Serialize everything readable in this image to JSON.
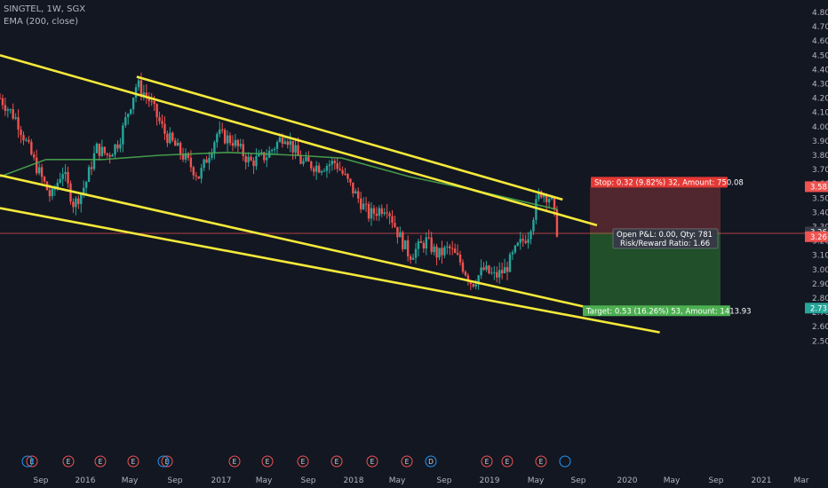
{
  "header": {
    "symbol_line": "SINGTEL, 1W, SGX",
    "indicator_line": "EMA (200, close)"
  },
  "colors": {
    "background": "#131722",
    "up": "#26a69a",
    "down": "#ef5350",
    "ema": "#4caf50",
    "channel": "#f5e93a",
    "stop_zone": "#ef5350",
    "target_zone": "#2e7d32",
    "axis_text": "#b2b5be"
  },
  "chart_data": {
    "type": "candlestick",
    "symbol": "SINGTEL",
    "interval": "1W",
    "exchange": "SGX",
    "y_ticks": [
      "4.80",
      "4.70",
      "4.60",
      "4.50",
      "4.40",
      "4.30",
      "4.20",
      "4.10",
      "4.00",
      "3.90",
      "3.80",
      "3.70",
      "3.60",
      "3.50",
      "3.40",
      "3.30",
      "3.20",
      "3.10",
      "3.00",
      "2.90",
      "2.80",
      "2.70",
      "2.60",
      "2.50"
    ],
    "x_ticks": [
      "Sep",
      "2016",
      "May",
      "Sep",
      "2017",
      "May",
      "Sep",
      "2018",
      "May",
      "Sep",
      "2019",
      "May",
      "Sep",
      "2020",
      "May",
      "Sep",
      "2021",
      "Mar"
    ],
    "ylim": [
      2.45,
      4.85
    ],
    "price_path": [
      [
        "2015-07-01",
        4.2
      ],
      [
        "2015-08-15",
        4.05
      ],
      [
        "2015-10-01",
        3.75
      ],
      [
        "2015-11-15",
        3.5
      ],
      [
        "2015-12-15",
        3.7
      ],
      [
        "2016-01-15",
        3.45
      ],
      [
        "2016-02-15",
        3.6
      ],
      [
        "2016-03-15",
        3.85
      ],
      [
        "2016-04-15",
        3.8
      ],
      [
        "2016-05-15",
        3.9
      ],
      [
        "2016-07-01",
        4.3
      ],
      [
        "2016-08-01",
        4.2
      ],
      [
        "2016-09-15",
        3.95
      ],
      [
        "2016-11-01",
        3.8
      ],
      [
        "2016-12-15",
        3.65
      ],
      [
        "2017-02-01",
        3.95
      ],
      [
        "2017-03-15",
        3.9
      ],
      [
        "2017-05-01",
        3.75
      ],
      [
        "2017-06-15",
        3.8
      ],
      [
        "2017-08-01",
        3.95
      ],
      [
        "2017-09-15",
        3.75
      ],
      [
        "2017-11-01",
        3.72
      ],
      [
        "2017-12-15",
        3.75
      ],
      [
        "2018-02-01",
        3.55
      ],
      [
        "2018-03-15",
        3.38
      ],
      [
        "2018-05-01",
        3.45
      ],
      [
        "2018-06-01",
        3.25
      ],
      [
        "2018-07-01",
        3.1
      ],
      [
        "2018-08-15",
        3.2
      ],
      [
        "2018-09-15",
        3.1
      ],
      [
        "2018-10-15",
        3.15
      ],
      [
        "2018-11-15",
        3.05
      ],
      [
        "2018-12-15",
        2.9
      ],
      [
        "2019-01-15",
        3.0
      ],
      [
        "2019-02-15",
        2.95
      ],
      [
        "2019-03-15",
        3.0
      ],
      [
        "2019-04-15",
        3.15
      ],
      [
        "2019-05-15",
        3.25
      ],
      [
        "2019-06-15",
        3.55
      ],
      [
        "2019-07-15",
        3.5
      ],
      [
        "2019-08-01",
        3.26
      ]
    ],
    "ema_200": [
      [
        "2015-07-01",
        3.65
      ],
      [
        "2015-11-01",
        3.77
      ],
      [
        "2016-04-01",
        3.77
      ],
      [
        "2016-09-01",
        3.8
      ],
      [
        "2017-03-01",
        3.82
      ],
      [
        "2017-09-01",
        3.8
      ],
      [
        "2018-01-01",
        3.78
      ],
      [
        "2018-07-01",
        3.65
      ],
      [
        "2019-01-01",
        3.55
      ],
      [
        "2019-08-01",
        3.42
      ]
    ],
    "trend_lines": [
      {
        "from": [
          "2015-07-01",
          4.5
        ],
        "to": [
          "2019-11-15",
          3.31
        ]
      },
      {
        "from": [
          "2016-07-01",
          4.35
        ],
        "to": [
          "2019-08-15",
          3.49
        ]
      },
      {
        "from": [
          "2015-07-01",
          3.66
        ],
        "to": [
          "2019-11-15",
          2.72
        ]
      },
      {
        "from": [
          "2015-07-01",
          3.43
        ],
        "to": [
          "2020-05-01",
          2.56
        ]
      }
    ],
    "position": {
      "entry": 3.26,
      "stop": 3.58,
      "target": 2.73,
      "stop_label": "Stop: 0.32 (9.82%) 32, Amount: 750.08",
      "target_label": "Target: 0.53 (16.26%) 53, Amount: 1413.93",
      "pnl_label": "Open P&L: 0.00, Qty: 781",
      "rr_label": "Risk/Reward Ratio: 1.66"
    },
    "price_tags": [
      {
        "text": "3.58",
        "value": 3.58,
        "color": "#ef5350"
      },
      {
        "text": "3.26",
        "value": 3.263,
        "color": "#363a45"
      },
      {
        "text": "3.26",
        "value": 3.23,
        "color": "#ef5350"
      },
      {
        "text": "2.73",
        "value": 2.73,
        "color": "#26a69a"
      }
    ],
    "event_markers": [
      "E",
      "E",
      "E",
      "E",
      "E",
      "E",
      "E",
      "E",
      "E",
      "E",
      "E",
      "D",
      "E",
      "E",
      "E"
    ]
  }
}
